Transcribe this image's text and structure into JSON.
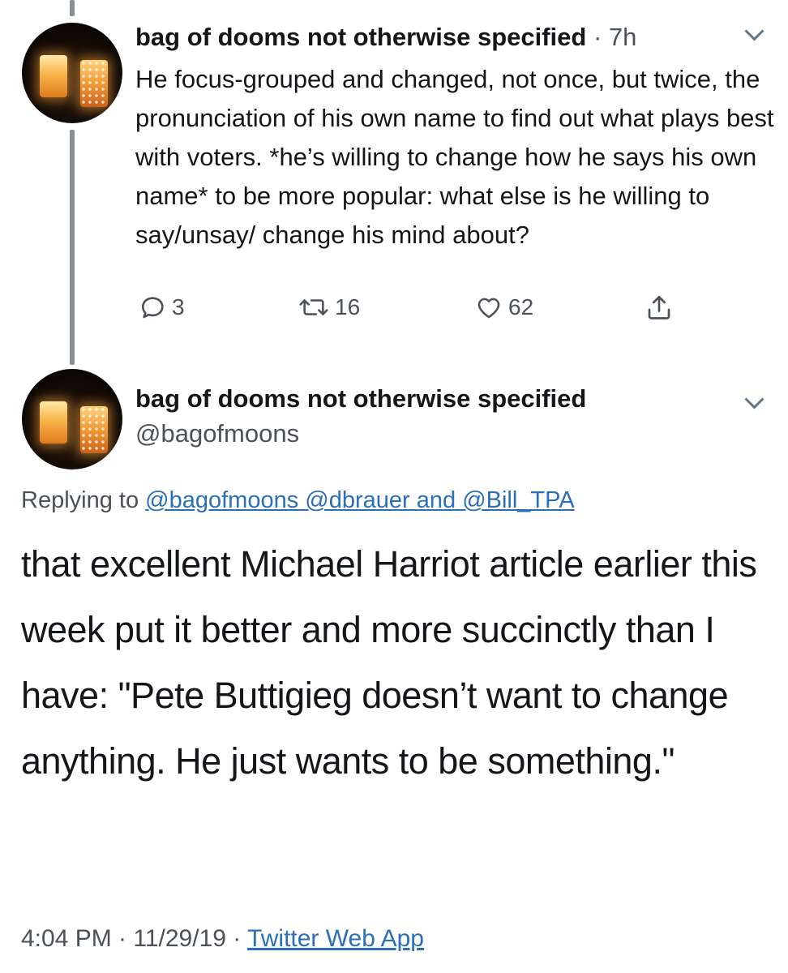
{
  "tweet1": {
    "display_name": "bag of dooms not otherwise specified",
    "separator": " · ",
    "time": "7h",
    "body": "He focus-grouped and changed, not once, but twice, the pronunciation of his own name to find out what plays best with voters. *he’s willing to change how he says his own name* to be more popular: what else is he willing to say/unsay/ change his mind about?",
    "replies": "3",
    "retweets": "16",
    "likes": "62"
  },
  "tweet2": {
    "display_name": "bag of dooms not otherwise specified",
    "handle": "@bagofmoons",
    "replying_prefix": "Replying to ",
    "reply_mention_1": "@bagofmoons",
    "reply_mention_2": "@dbrauer",
    "reply_and": " and ",
    "reply_mention_3": "@Bill_TPA",
    "body": "that excellent Michael Harriot article earlier this week put it better and more succinctly than I have: \"Pete Buttigieg doesn’t want to change anything. He just wants to be something.\"",
    "timestamp": "4:04 PM · 11/29/19 · ",
    "client": "Twitter Web App"
  },
  "icons": [
    "reply-icon",
    "retweet-icon",
    "like-icon",
    "share-icon",
    "chevron-down-icon"
  ],
  "colors": {
    "link": "#2a6fb8",
    "muted": "#4a5258",
    "text": "#14171a",
    "thread_line": "#8a8f94"
  }
}
